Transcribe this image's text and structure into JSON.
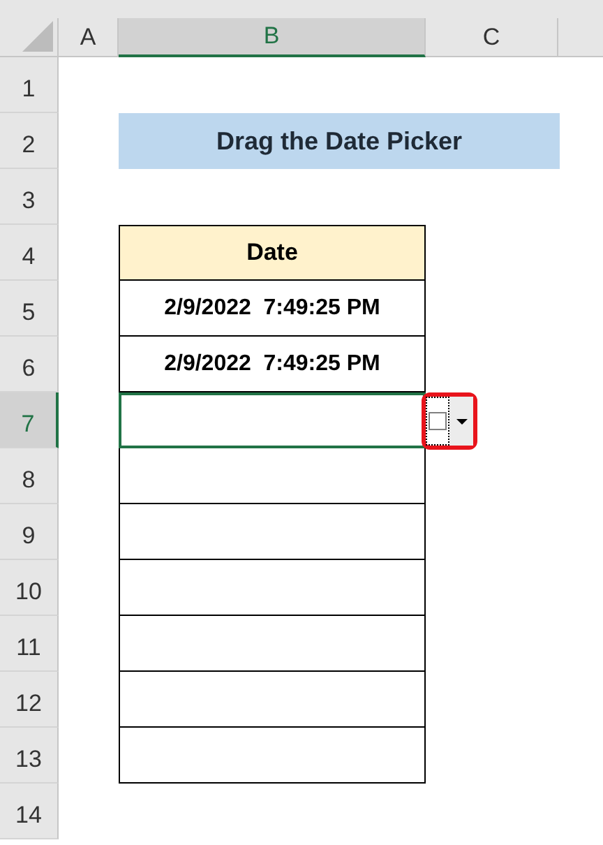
{
  "columns": [
    {
      "label": "A",
      "selected": false
    },
    {
      "label": "B",
      "selected": true
    },
    {
      "label": "C",
      "selected": false
    }
  ],
  "row_headers": [
    {
      "label": "1",
      "selected": false
    },
    {
      "label": "2",
      "selected": false
    },
    {
      "label": "3",
      "selected": false
    },
    {
      "label": "4",
      "selected": false
    },
    {
      "label": "5",
      "selected": false
    },
    {
      "label": "6",
      "selected": false
    },
    {
      "label": "7",
      "selected": true
    },
    {
      "label": "8",
      "selected": false
    },
    {
      "label": "9",
      "selected": false
    },
    {
      "label": "10",
      "selected": false
    },
    {
      "label": "11",
      "selected": false
    },
    {
      "label": "12",
      "selected": false
    },
    {
      "label": "13",
      "selected": false
    },
    {
      "label": "14",
      "selected": false
    }
  ],
  "title": "Drag the Date Picker",
  "table": {
    "header": "Date",
    "rows": [
      {
        "date": "2/9/2022  7:49:25 PM",
        "selected": false
      },
      {
        "date": "2/9/2022  7:49:25 PM",
        "selected": false
      },
      {
        "selected": true
      },
      {
        "selected": false
      },
      {
        "selected": false
      },
      {
        "selected": false
      },
      {
        "selected": false
      },
      {
        "selected": false
      },
      {
        "selected": false
      }
    ]
  },
  "date_picker": {
    "checked": false
  }
}
